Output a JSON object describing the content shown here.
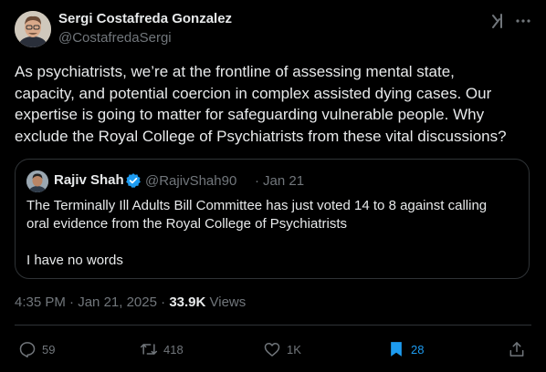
{
  "tweet": {
    "author": {
      "name": "Sergi Costafreda Gonzalez",
      "handle": "@CostafredaSergi"
    },
    "text_lines": [
      "As psychiatrists, we’re at the frontline of assessing mental state,",
      "capacity, and potential coercion in complex assisted dying cases. Our",
      "expertise is going to matter for safeguarding vulnerable people. Why",
      "exclude the Royal College of Psychiatrists from these vital discussions?"
    ],
    "quoted": {
      "name": "Rajiv Shah",
      "handle": "@RajivShah90",
      "separator": "·",
      "date": "Jan 21",
      "text_lines": [
        "The Terminally Ill Adults Bill Committee has just voted 14 to 8 against calling",
        "oral evidence from the Royal College of Psychiatrists"
      ],
      "text_line_last": "I have no words"
    },
    "meta": {
      "time": "4:35 PM",
      "separator": "·",
      "date": "Jan 21, 2025",
      "separator2": "·",
      "views_count": "33.9K",
      "views_label": "Views"
    },
    "actions": {
      "replies": "59",
      "reposts": "418",
      "likes": "1K",
      "bookmarks": "28"
    }
  },
  "colors": {
    "background": "#000000",
    "text": "#e7e9ea",
    "muted": "#71767b",
    "border": "#2f3336",
    "accent": "#1d9bf0"
  },
  "icons": [
    "grok-icon",
    "more-icon",
    "verified-icon",
    "reply-icon",
    "repost-icon",
    "like-icon",
    "bookmark-icon",
    "share-icon"
  ]
}
